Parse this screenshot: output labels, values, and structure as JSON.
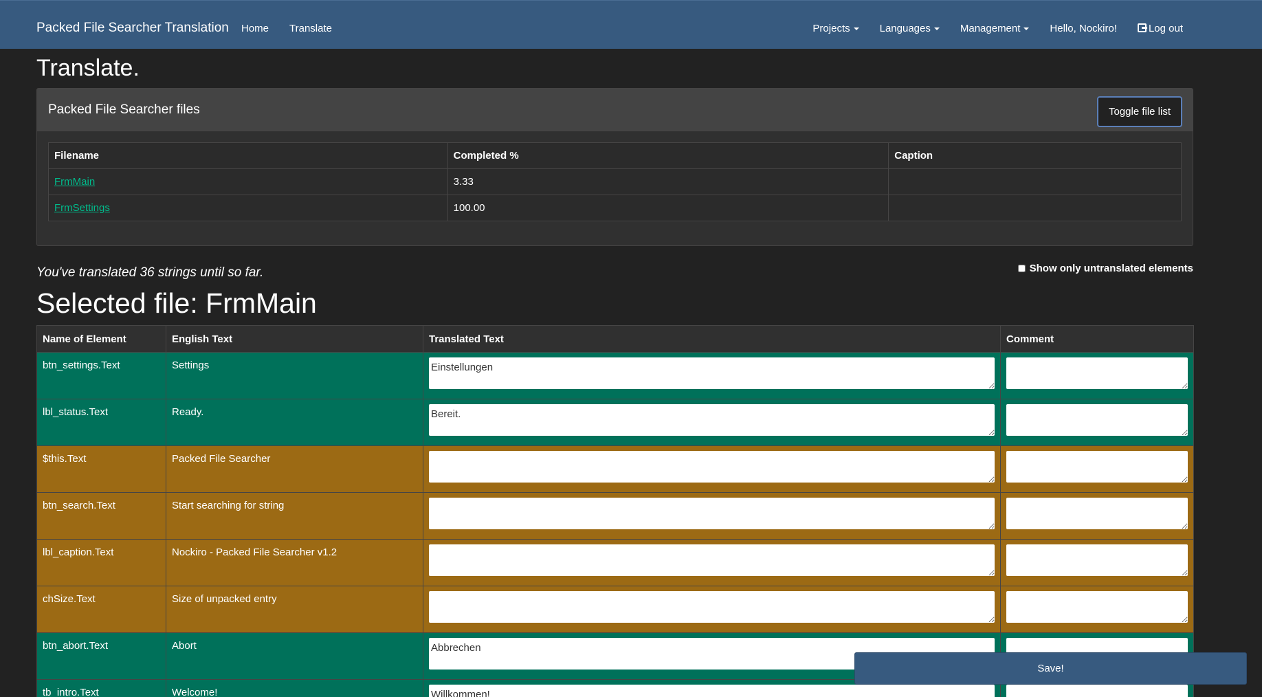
{
  "navbar": {
    "brand": "Packed File Searcher Translation",
    "left_links": [
      "Home",
      "Translate"
    ],
    "projects": "Projects",
    "languages": "Languages",
    "management": "Management",
    "greeting": "Hello, Nockiro!",
    "logout": "Log out"
  },
  "page_title": "Translate.",
  "files_panel": {
    "title": "Packed File Searcher files",
    "toggle_label": "Toggle file list",
    "headers": [
      "Filename",
      "Completed %",
      "Caption"
    ],
    "rows": [
      {
        "filename": "FrmMain",
        "completed": "3.33",
        "caption": ""
      },
      {
        "filename": "FrmSettings",
        "completed": "100.00",
        "caption": ""
      }
    ]
  },
  "progress_note": "You've translated 36 strings until so far.",
  "filter_label": "Show only untranslated elements",
  "selected_file": "Selected file: FrmMain",
  "translation_table": {
    "headers": [
      "Name of Element",
      "English Text",
      "Translated Text",
      "Comment"
    ],
    "rows": [
      {
        "name": "btn_settings.Text",
        "english": "Settings",
        "translated": "Einstellungen",
        "comment": "",
        "status": "done"
      },
      {
        "name": "lbl_status.Text",
        "english": "Ready.",
        "translated": "Bereit.",
        "comment": "",
        "status": "done"
      },
      {
        "name": "$this.Text",
        "english": "Packed File Searcher",
        "translated": "",
        "comment": "",
        "status": "todo"
      },
      {
        "name": "btn_search.Text",
        "english": "Start searching for string",
        "translated": "",
        "comment": "",
        "status": "todo"
      },
      {
        "name": "lbl_caption.Text",
        "english": "Nockiro - Packed File Searcher v1.2",
        "translated": "",
        "comment": "",
        "status": "todo"
      },
      {
        "name": "chSize.Text",
        "english": "Size of unpacked entry",
        "translated": "",
        "comment": "",
        "status": "todo"
      },
      {
        "name": "btn_abort.Text",
        "english": "Abort",
        "translated": "Abbrechen",
        "comment": "",
        "status": "done"
      },
      {
        "name": "tb_intro.Text",
        "english": "Welcome!",
        "translated": "Willkommen!",
        "comment": "",
        "status": "done"
      }
    ]
  },
  "save_label": "Save!",
  "colors": {
    "navbar": "#375a7f",
    "translated_row": "#00715a",
    "untranslated_row": "#9c6a14",
    "background": "#222222",
    "link": "#00bc8c"
  }
}
